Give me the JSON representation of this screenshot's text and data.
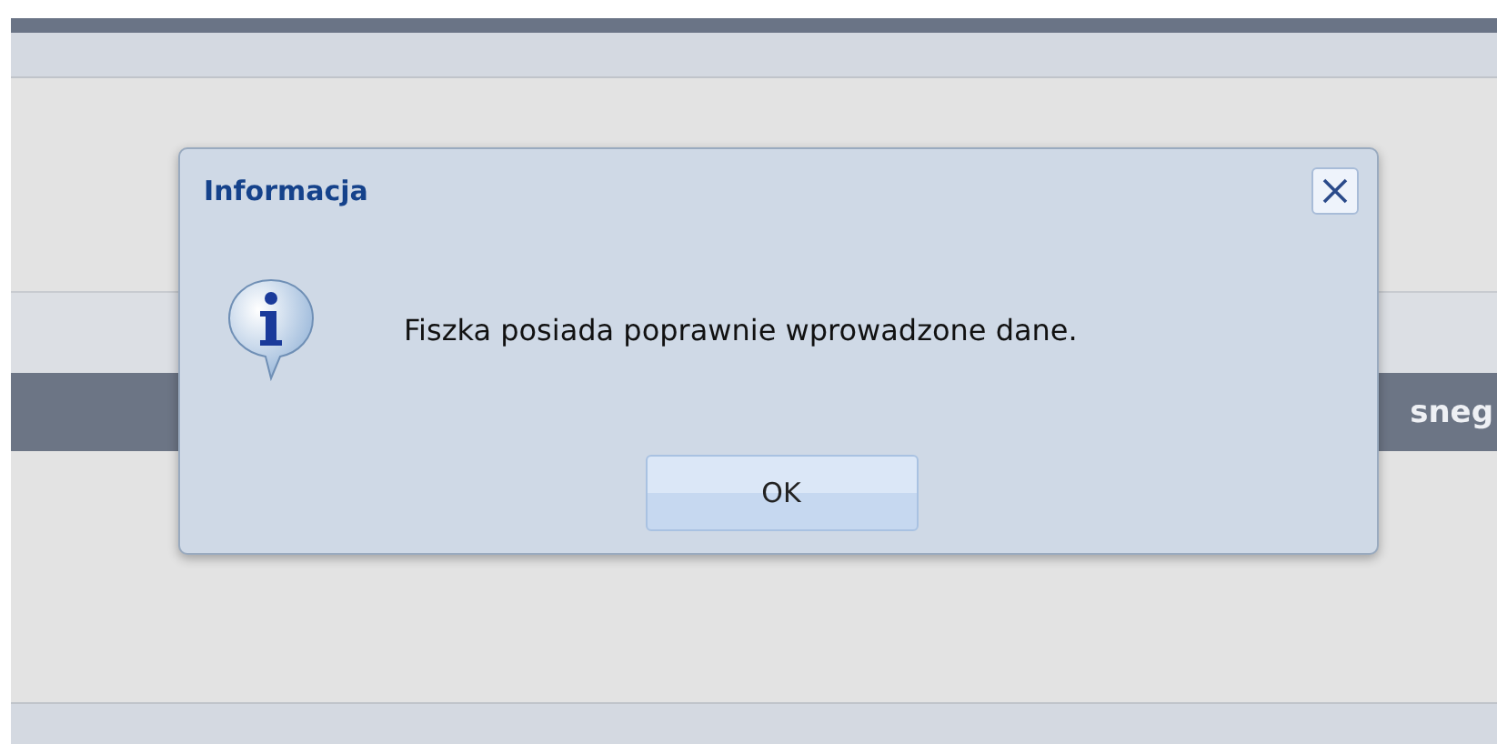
{
  "background": {
    "header_text": "sneg"
  },
  "dialog": {
    "title": "Informacja",
    "message": "Fiszka posiada poprawnie wprowadzone dane.",
    "buttons": [
      "OK"
    ]
  }
}
